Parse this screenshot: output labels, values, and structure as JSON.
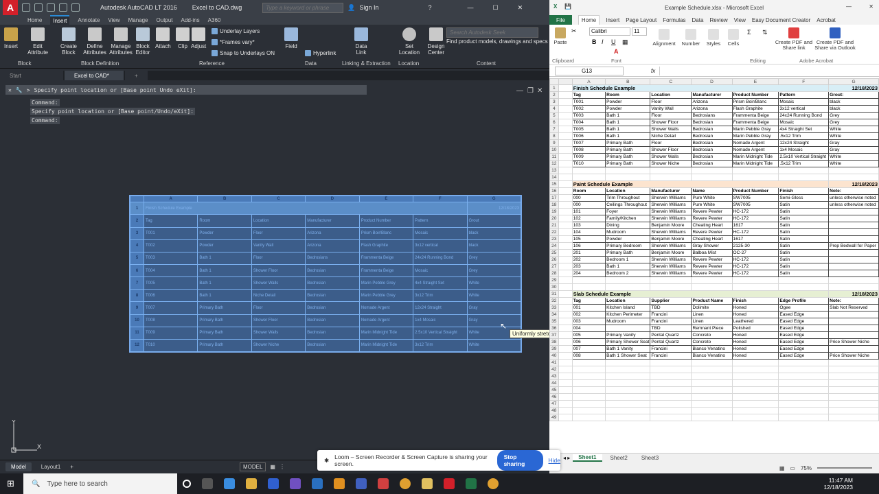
{
  "acad": {
    "app_title": "Autodesk AutoCAD LT 2016",
    "file_title": "Excel to CAD.dwg",
    "search_placeholder": "Type a keyword or phrase",
    "sign_in": "Sign In",
    "tabs": [
      "Home",
      "Insert",
      "Annotate",
      "View",
      "Manage",
      "Output",
      "Add-ins",
      "A360"
    ],
    "active_tab": "Insert",
    "ribbon": {
      "insert": "Insert",
      "edit_attribute": "Edit Attribute",
      "create_block": "Create Block",
      "define_attributes": "Define Attributes",
      "manage_attributes": "Manage Attributes",
      "block_editor": "Block Editor",
      "attach": "Attach",
      "clip": "Clip",
      "adjust": "Adjust",
      "underlay_layers": "Underlay Layers",
      "frames_vary": "*Frames vary*",
      "snap_underlays": "Snap to Underlays ON",
      "field": "Field",
      "hyperlink": "Hyperlink",
      "data_link": "Data Link",
      "set_location": "Set Location",
      "design_center": "Design Center",
      "seek_placeholder": "Search Autodesk Seek",
      "seek_text": "Find product models, drawings and specs",
      "groups": [
        "Block",
        "Block Definition",
        "Reference",
        "Data",
        "Linking & Extraction",
        "Location",
        "Content"
      ]
    },
    "doc_tabs": [
      "Start",
      "Excel to CAD*"
    ],
    "command_prompt": "Specify point location or [Base point Undo eXit]:",
    "history": [
      "Command:",
      "Specify point location or [Base point/Undo/eXit]:",
      "Command:"
    ],
    "table": {
      "columns": [
        "A",
        "B",
        "C",
        "D",
        "E",
        "F",
        "G"
      ],
      "title": "Finish Schedule Example",
      "date": "12/18/2023",
      "rows": [
        [
          "Tag",
          "Room",
          "Location",
          "Manufacturer",
          "Product Number",
          "Pattern",
          "Grout"
        ],
        [
          "T001",
          "Powder",
          "Floor",
          "Arizona",
          "Prism Boir/Blanc",
          "Mosaic",
          "black"
        ],
        [
          "T002",
          "Powder",
          "Vanity Wall",
          "Arizona",
          "Flash Graphite",
          "3x12 vertical",
          "black"
        ],
        [
          "T003",
          "Bath 1",
          "Floor",
          "Bedrosians",
          "Frammenta Beige",
          "24x24 Running Bond",
          "Grey"
        ],
        [
          "T004",
          "Bath 1",
          "Shower Floor",
          "Bedrosian",
          "Frammenta Beige",
          "Mosaic",
          "Grey"
        ],
        [
          "T005",
          "Bath 1",
          "Shower Walls",
          "Bedrosian",
          "Marin Pebble Grey",
          "4x4 Straight Set",
          "White"
        ],
        [
          "T006",
          "Bath 1",
          "Niche Detail",
          "Bedrosian",
          "Marin Pebble Grey",
          "3x12 Trim",
          "White"
        ],
        [
          "T007",
          "Primary Bath",
          "Floor",
          "Bedrosian",
          "Nomade Argent",
          "12x24 Straight",
          "Gray"
        ],
        [
          "T008",
          "Primary Bath",
          "Shower Floor",
          "Bedrosian",
          "Nomade Argent",
          "1x4 Mosaic",
          "Gray"
        ],
        [
          "T009",
          "Primary Bath",
          "Shower Walls",
          "Bedrosian",
          "Marin Midnight Tide",
          "2.5x10 Vertical Straight",
          "White"
        ],
        [
          "T010",
          "Primary Bath",
          "Shower Niche",
          "Bedrosian",
          "Marin Midnight Tide",
          "3x12 Trim",
          "White"
        ]
      ]
    },
    "tooltip": "Uniformly stretch table width and height",
    "layout_tabs": [
      "Model",
      "Layout1"
    ],
    "model_label": "MODEL"
  },
  "excel": {
    "title": "Example Schedule.xlsx - Microsoft Excel",
    "tabs": [
      "File",
      "Home",
      "Insert",
      "Page Layout",
      "Formulas",
      "Data",
      "Review",
      "View",
      "Easy Document Creator",
      "Acrobat"
    ],
    "font_name": "Calibri",
    "font_size": "11",
    "ribbon": {
      "paste": "Paste",
      "alignment": "Alignment",
      "number": "Number",
      "styles": "Styles",
      "cells": "Cells",
      "create_pdf_share": "Create PDF and Share link",
      "create_pdf_outlook": "Create PDF and Share via Outlook",
      "groups": [
        "Clipboard",
        "Font",
        "Editing",
        "Adobe Acrobat"
      ]
    },
    "name_box": "G13",
    "col_letters": [
      "A",
      "B",
      "C",
      "D",
      "E",
      "F",
      "G"
    ],
    "finish": {
      "title": "Finish Schedule Example",
      "date": "12/18/2023",
      "header": [
        "Tag",
        "Room",
        "Location",
        "Manufacturer",
        "Product Number",
        "Pattern",
        "Grout:"
      ],
      "rows": [
        [
          "T001",
          "Powder",
          "Floor",
          "Arizona",
          "Prism Boir/Blanc",
          "Mosaic",
          "black"
        ],
        [
          "T002",
          "Powder",
          "Vanity Wall",
          "Arizona",
          "Flash Graphite",
          "3x12 vertical",
          "black"
        ],
        [
          "T003",
          "Bath 1",
          "Floor",
          "Bedrosians",
          "Frammenta Beige",
          "24x24 Running Bond",
          "Grey"
        ],
        [
          "T004",
          "Bath 1",
          "Shower Floor",
          "Bedrosian",
          "Frammenta Beige",
          "Mosaic",
          "Grey"
        ],
        [
          "T005",
          "Bath 1",
          "Shower Walls",
          "Bedrosian",
          "Marin Pebble Gray",
          "4x4 Straight Set",
          "White"
        ],
        [
          "T006",
          "Bath 1",
          "Niche Detail",
          "Bedrosian",
          "Marin Pebble Gray",
          ".5x12 Trim",
          "White"
        ],
        [
          "T007",
          "Primary Bath",
          "Floor",
          "Bedrosian",
          "Nomade Argent",
          "12x24 Straight",
          "Gray"
        ],
        [
          "T008",
          "Primary Bath",
          "Shower Floor",
          "Bedrosian",
          "Nomade Argent",
          "1x4 Mosaic",
          "Gray"
        ],
        [
          "T009",
          "Primary Bath",
          "Shower Walls",
          "Bedrosian",
          "Marin Midnight Tide",
          "2.5x10 Vertical Straight",
          "White"
        ],
        [
          "T010",
          "Primary Bath",
          "Shower Niche",
          "Bedrosian",
          "Marin Midnight Tide",
          ".5x12 Trim",
          "White"
        ]
      ]
    },
    "paint": {
      "title": "Paint Schedule Example",
      "date": "12/18/2023",
      "header": [
        "Room",
        "Location",
        "Manufacturer",
        "Name",
        "Product Number",
        "Finish",
        "Note:"
      ],
      "rows": [
        [
          "000",
          "Trim Throughout",
          "Sherwin Williams",
          "Pure White",
          "SW7005",
          "Semi-Gloss",
          "unless otherwise noted"
        ],
        [
          "000",
          "Ceilings Throughout",
          "Sherwin Williams",
          "Pure White",
          "SW7005",
          "Satin",
          "unless otherwise noted"
        ],
        [
          "101",
          "Foyer",
          "Sherwin Williams",
          "Revere Pewter",
          "HC-172",
          "Satin",
          ""
        ],
        [
          "102",
          "Family/Kitchen",
          "Sherwin Williams",
          "Revere Pewter",
          "HC-172",
          "Satin",
          ""
        ],
        [
          "103",
          "Dining",
          "Benjamin Moore",
          "Cheating Heart",
          "1617",
          "Satin",
          ""
        ],
        [
          "104",
          "Mudroom",
          "Sherwin Williams",
          "Revere Pewter",
          "HC-172",
          "Satin",
          ""
        ],
        [
          "105",
          "Powder",
          "Benjamin Moore",
          "Cheating Heart",
          "1617",
          "Satin",
          ""
        ],
        [
          "106",
          "Primary Bedroom",
          "Sherwin Williams",
          "Gray Shower",
          "2125-30",
          "Satin",
          "Prep Bedwall for Paper"
        ],
        [
          "201",
          "Primary Bath",
          "Benjamin Moore",
          "Balboa Mist",
          "OC-27",
          "Satin",
          ""
        ],
        [
          "202",
          "Bedroom 1",
          "Sherwin Williams",
          "Revere Pewter",
          "HC-172",
          "Satin",
          ""
        ],
        [
          "203",
          "Bath 1",
          "Sherwin Williams",
          "Revere Pewter",
          "HC-172",
          "Satin",
          ""
        ],
        [
          "204",
          "Bedroom 2",
          "Sherwin Williams",
          "Revere Pewter",
          "HC-172",
          "Satin",
          ""
        ]
      ]
    },
    "slab": {
      "title": "Slab Schedule Example",
      "date": "12/18/2023",
      "header": [
        "Tag",
        "Location",
        "Supplier",
        "Product Name",
        "Finish",
        "Edge Profile",
        "Note:"
      ],
      "rows": [
        [
          "001",
          "Kitchen Island",
          "TBD",
          "Dolimite",
          "Honed",
          "Ogee",
          "Slab Not Reserved"
        ],
        [
          "002",
          "Kitchen Perimeter",
          "Francini",
          "Linen",
          "Honed",
          "Eased Edge",
          ""
        ],
        [
          "003",
          "Mudroom",
          "Francini",
          "Linen",
          "Leathered",
          "Eased Edge",
          ""
        ],
        [
          "004",
          "",
          "TBD",
          "Remnant Piece",
          "Polished",
          "Eased Edge",
          ""
        ],
        [
          "005",
          "Primary Vanity",
          "Pental Quartz",
          "Concreto",
          "Honed",
          "Eased Edge",
          ""
        ],
        [
          "006",
          "Primary Shower Seat",
          "Pental Quartz",
          "Concreto",
          "Honed",
          "Eased Edge",
          "Price Shower Niche"
        ],
        [
          "007",
          "Bath 1 Vanity",
          "Francini",
          "Bianco Venatino",
          "Honed",
          "Eased Edge",
          ""
        ],
        [
          "008",
          "Bath 1 Shower Seat",
          "Francini",
          "Bianco Venatino",
          "Honed",
          "Eased Edge",
          "Price Shower Niche"
        ]
      ]
    },
    "sheet_tabs": [
      "Sheet1",
      "Sheet2",
      "Sheet3"
    ],
    "zoom": "75%"
  },
  "loom": {
    "message": "Loom – Screen Recorder & Screen Capture is sharing your screen.",
    "stop": "Stop sharing",
    "hide": "Hide"
  },
  "taskbar": {
    "search": "Type here to search",
    "time": "11:47 AM",
    "date": "12/18/2023"
  }
}
